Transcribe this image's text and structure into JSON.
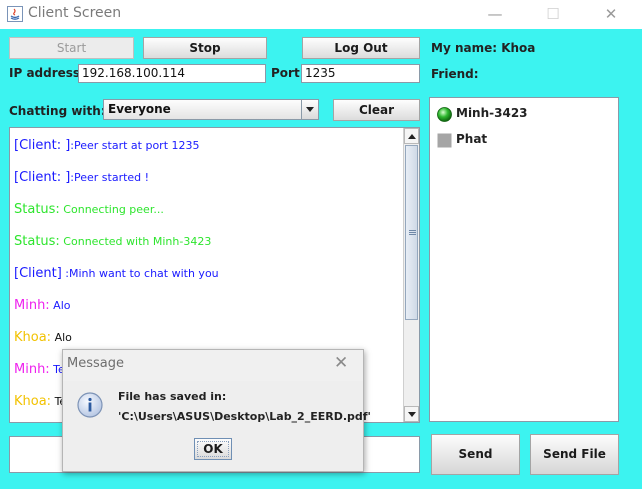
{
  "window": {
    "title": "Client Screen",
    "minimize_glyph": "—",
    "maximize_glyph": "☐",
    "close_glyph": "✕"
  },
  "toolbar": {
    "start_label": "Start",
    "stop_label": "Stop",
    "logout_label": "Log Out",
    "my_name_label": "My name: Khoa",
    "friend_label": "Friend:"
  },
  "connection": {
    "ip_label": "IP address:",
    "ip_value": "192.168.100.114",
    "port_label": "Port:",
    "port_value": "1235"
  },
  "chat_target": {
    "label": "Chatting with:",
    "selected": "Everyone",
    "clear_label": "Clear"
  },
  "colors": {
    "background": "#3cf3f0",
    "client": "#1a1aff",
    "status": "#2ee52e",
    "minh": "#ee22ee",
    "khoa": "#f2c200"
  },
  "messages": [
    {
      "prefix": "[Client: ]",
      "text": ":Peer start at port 1235",
      "color": "#1a1aff"
    },
    {
      "prefix": "[Client: ]",
      "text": ":Peer started !",
      "color": "#1a1aff"
    },
    {
      "prefix": "Status:",
      "text": " Connecting peer...",
      "color": "#2ee52e"
    },
    {
      "prefix": "Status:",
      "text": " Connected with Minh-3423",
      "color": "#2ee52e"
    },
    {
      "prefix": "[Client]",
      "text": " :Minh want to chat with you",
      "color": "#1a1aff"
    },
    {
      "prefix": "Minh:",
      "text": " Alo",
      "color": "#ee22ee",
      "text_color": "#1a1aff"
    },
    {
      "prefix": "Khoa:",
      "text": " Alo",
      "color": "#f2c200",
      "text_color": "#111111"
    },
    {
      "prefix": "Minh:",
      "text": " Te",
      "color": "#ee22ee",
      "text_color": "#1a1aff"
    },
    {
      "prefix": "Khoa:",
      "text": " Te",
      "color": "#f2c200",
      "text_color": "#111111"
    }
  ],
  "friends": [
    {
      "name": "Minh-3423",
      "status": "online",
      "icon": "green-ball-icon"
    },
    {
      "name": "Phat",
      "status": "offline",
      "icon": "gray-square-icon"
    }
  ],
  "actions": {
    "send_label": "Send",
    "send_file_label": "Send File"
  },
  "dialog": {
    "title": "Message",
    "line1": "File has saved in:",
    "line2": "'C:\\Users\\ASUS\\Desktop\\Lab_2_EERD.pdf'",
    "ok_label": "OK",
    "icon": "info-icon"
  }
}
